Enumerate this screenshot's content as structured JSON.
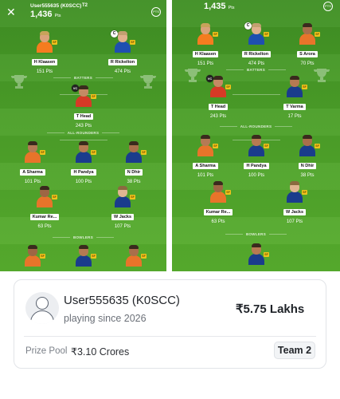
{
  "panel_left": {
    "username": "User555635 (K0SCC)",
    "team_tag": "T2",
    "total_points": "1,436",
    "points_unit": "Pts",
    "pts_icon_text": "PTS",
    "sections": {
      "batters": "BATTERS",
      "all_rounders": "ALL-ROUNDERS",
      "bowlers": "BOWLERS"
    },
    "players": [
      {
        "name": "H Klaasen",
        "points": "151 Pts",
        "cap": ""
      },
      {
        "name": "R Rickelton",
        "points": "474 Pts",
        "cap": "C"
      },
      {
        "name": "T Head",
        "points": "243 Pts",
        "cap": "VC"
      },
      {
        "name": "A Sharma",
        "points": "101 Pts",
        "cap": ""
      },
      {
        "name": "H Pandya",
        "points": "100 Pts",
        "cap": ""
      },
      {
        "name": "N Dhir",
        "points": "38 Pts",
        "cap": ""
      },
      {
        "name": "Kumar Re...",
        "points": "63 Pts",
        "cap": ""
      },
      {
        "name": "W Jacks",
        "points": "107 Pts",
        "cap": ""
      }
    ]
  },
  "panel_right": {
    "total_points": "1,435",
    "points_unit": "Pts",
    "pts_icon_text": "PTS",
    "sections": {
      "batters": "BATTERS",
      "all_rounders": "ALL-ROUNDERS",
      "bowlers": "BOWLERS"
    },
    "players": [
      {
        "name": "H Klaasen",
        "points": "151 Pts",
        "cap": ""
      },
      {
        "name": "R Rickelton",
        "points": "474 Pts",
        "cap": "C"
      },
      {
        "name": "S Arora",
        "points": "70 Pts",
        "cap": ""
      },
      {
        "name": "T Head",
        "points": "243 Pts",
        "cap": "VC"
      },
      {
        "name": "T Varma",
        "points": "17 Pts",
        "cap": ""
      },
      {
        "name": "A Sharma",
        "points": "101 Pts",
        "cap": ""
      },
      {
        "name": "H Pandya",
        "points": "100 Pts",
        "cap": ""
      },
      {
        "name": "N Dhir",
        "points": "38 Pts",
        "cap": ""
      },
      {
        "name": "Kumar Re...",
        "points": "63 Pts",
        "cap": ""
      },
      {
        "name": "W Jacks",
        "points": "107 Pts",
        "cap": ""
      }
    ]
  },
  "card": {
    "user_name": "User555635 (K0SCC)",
    "playing_since": "playing since 2026",
    "winnings": "₹5.75 Lakhs",
    "prize_pool_label": "Prize Pool",
    "prize_pool_value": "₹3.10 Crores",
    "team_label": "Team 2"
  },
  "colors": {
    "pitch": "#4a9e28",
    "badge": "#f0c21b",
    "card_border": "#e2e4e8"
  }
}
